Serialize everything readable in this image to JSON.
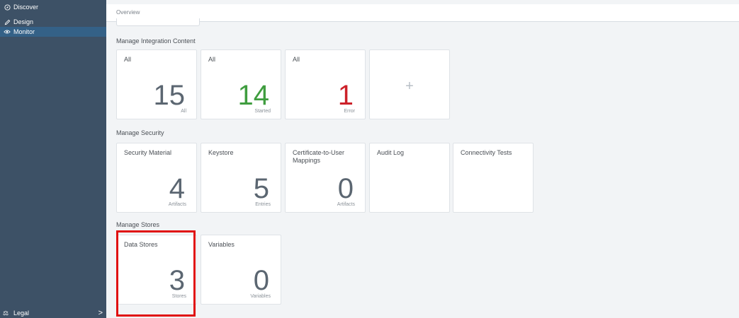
{
  "sidebar": {
    "items": [
      {
        "label": "Discover",
        "icon": "compass-icon"
      },
      {
        "label": "Design",
        "icon": "pencil-icon"
      },
      {
        "label": "Monitor",
        "icon": "eye-icon"
      }
    ],
    "footer": {
      "label": "Legal",
      "icon": "legal-icon",
      "chevron": ">"
    }
  },
  "header": {
    "breadcrumb": "Overview"
  },
  "sections": {
    "integration": {
      "title": "Manage Integration Content",
      "tiles": [
        {
          "title": "All",
          "value": "15",
          "unit": "All",
          "color": "#5b6671"
        },
        {
          "title": "All",
          "value": "14",
          "unit": "Started",
          "color": "#3f9d3f"
        },
        {
          "title": "All",
          "value": "1",
          "unit": "Error",
          "color": "#cc2129"
        },
        {
          "plus": "+"
        }
      ]
    },
    "security": {
      "title": "Manage Security",
      "tiles": [
        {
          "title": "Security Material",
          "value": "4",
          "unit": "Artifacts"
        },
        {
          "title": "Keystore",
          "value": "5",
          "unit": "Entries"
        },
        {
          "title": "Certificate-to-User Mappings",
          "value": "0",
          "unit": "Artifacts"
        },
        {
          "title": "Audit Log"
        },
        {
          "title": "Connectivity Tests"
        }
      ]
    },
    "stores": {
      "title": "Manage Stores",
      "tiles": [
        {
          "title": "Data Stores",
          "value": "3",
          "unit": "Stores"
        },
        {
          "title": "Variables",
          "value": "0",
          "unit": "Variables"
        }
      ]
    }
  },
  "colors": {
    "sidebar": "#3d5166",
    "active": "#346187",
    "highlight": "#e01010"
  }
}
